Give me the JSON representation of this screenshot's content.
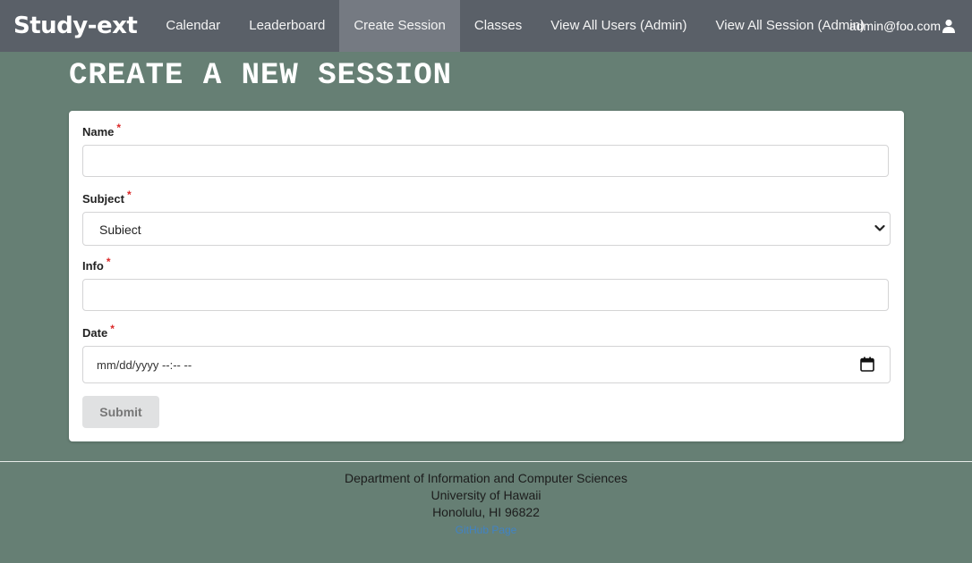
{
  "navbar": {
    "brand": "Study-ext",
    "items": [
      {
        "label": "Calendar"
      },
      {
        "label": "Leaderboard"
      },
      {
        "label": "Create Session"
      },
      {
        "label": "Classes"
      },
      {
        "label": "View All Users (Admin)"
      },
      {
        "label": "View All Session (Admin)"
      }
    ],
    "active_item": "Create Session",
    "user": "admin@foo.com",
    "user_icon": "user-icon"
  },
  "page": {
    "title": "CREATE A NEW SESSION"
  },
  "form": {
    "required_marker": "*",
    "name": {
      "label": "Name",
      "value": "",
      "placeholder": ""
    },
    "subject": {
      "label": "Subject",
      "selected": "Subiect",
      "icon": "chevron-down-icon"
    },
    "info": {
      "label": "Info",
      "value": "",
      "placeholder": ""
    },
    "date": {
      "label": "Date",
      "value": "mm/dd/yyyy --:-- --",
      "icon": "calendar-icon"
    },
    "submit_label": "Submit"
  },
  "footer": {
    "line1": "Department of Information and Computer Sciences",
    "line2": "University of Hawaii",
    "line3": "Honolulu, HI 96822",
    "link": "GitHub Page"
  },
  "colors": {
    "page_bg": "#667f74",
    "navbar_bg": "#5a6068",
    "navbar_active": "#757a82",
    "required": "#db2828",
    "link": "#4183c4"
  }
}
